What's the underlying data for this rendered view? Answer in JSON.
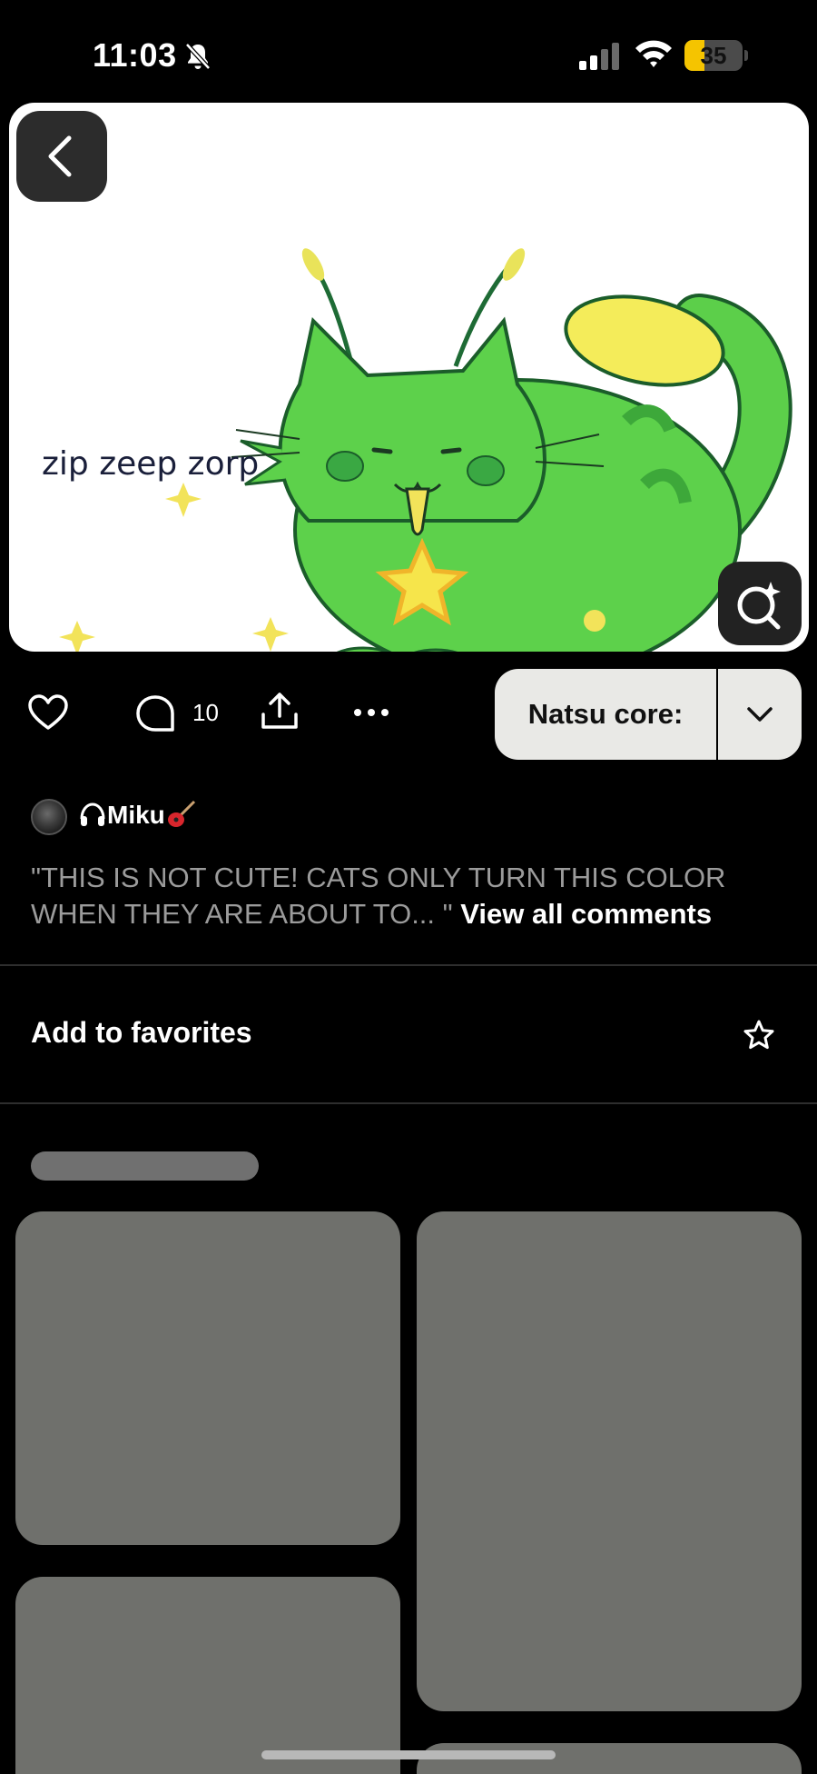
{
  "status_bar": {
    "time": "11:03",
    "battery_level": "35",
    "battery_fraction": 0.35,
    "accent_color": "#f5c400"
  },
  "pin": {
    "image_caption": "zip zeep zorp",
    "image_icon": "green-cat-illustration",
    "back_icon": "chevron-left-icon",
    "lens_icon": "visual-search-sparkle-icon"
  },
  "actions": {
    "comment_count": "10",
    "board_label": "Natsu core:"
  },
  "comment": {
    "username": "Miku",
    "username_prefix_icon": "headphones-icon",
    "username_suffix_icon": "guitar-icon",
    "text": "\"THIS IS NOT CUTE! CATS ONLY TURN THIS COLOR WHEN THEY ARE ABOUT TO... \"",
    "view_all": "View all comments"
  },
  "favorites": {
    "label": "Add to favorites",
    "icon": "star-outline-icon"
  },
  "colors": {
    "background": "#000000",
    "skeleton": "#6f706c",
    "button_bg": "#e9e9e6",
    "muted_text": "#9b9b9b"
  }
}
